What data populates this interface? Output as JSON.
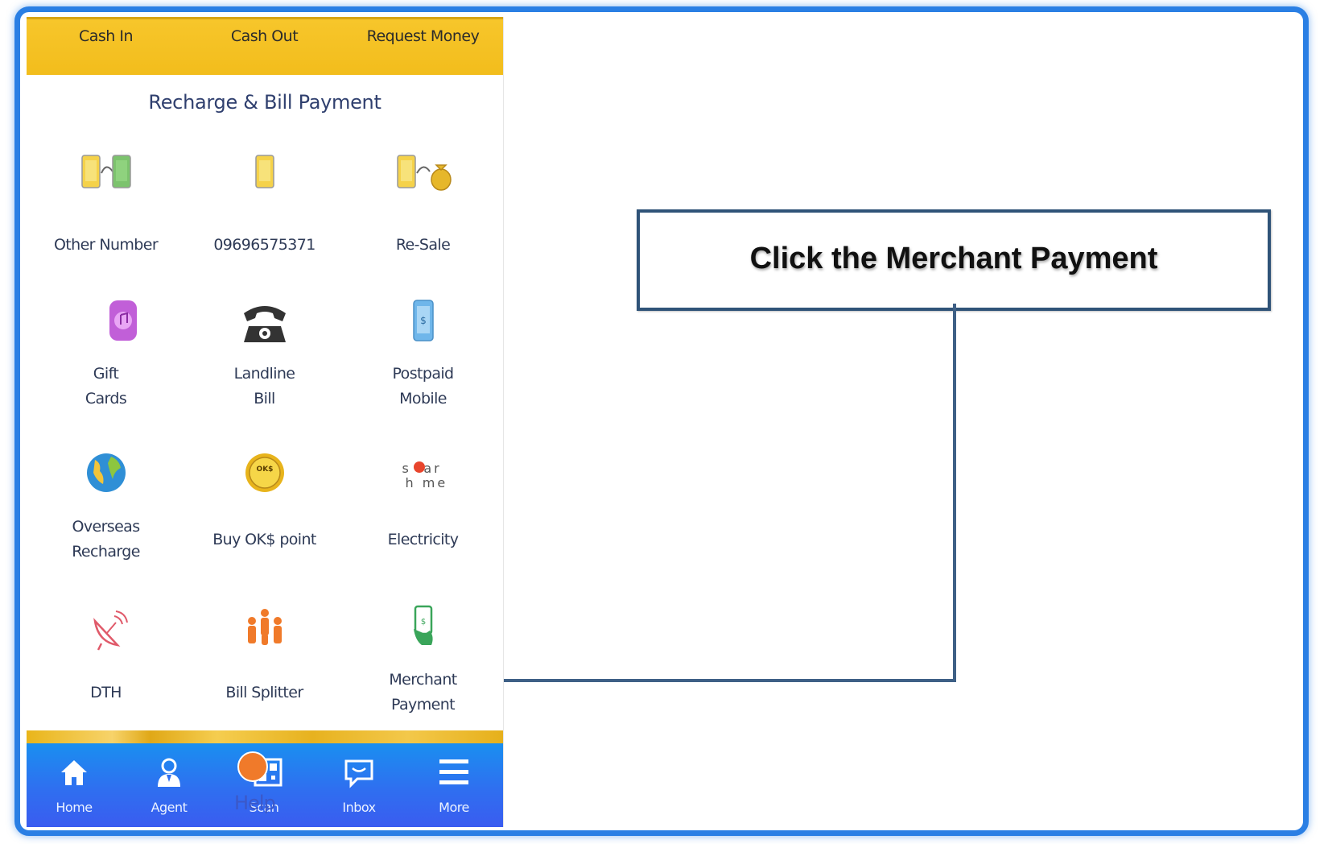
{
  "top_tabs": [
    "Cash In",
    "Cash Out",
    "Request Money"
  ],
  "section_title": "Recharge & Bill Payment",
  "grid": [
    {
      "icon": "phone-transfer-icon",
      "line1": "Other Number",
      "line2": ""
    },
    {
      "icon": "mobile-phone-icon",
      "line1": "09696575371",
      "line2": ""
    },
    {
      "icon": "phone-money-bag-icon",
      "line1": "Re-Sale",
      "line2": ""
    },
    {
      "icon": "gift-card-icon",
      "line1": "Gift",
      "line2": "Cards"
    },
    {
      "icon": "telephone-icon",
      "line1": "Landline",
      "line2": "Bill"
    },
    {
      "icon": "postpaid-mobile-icon",
      "line1": "Postpaid",
      "line2": "Mobile"
    },
    {
      "icon": "globe-icon",
      "line1": "Overseas",
      "line2": "Recharge"
    },
    {
      "icon": "ok-coin-icon",
      "line1": "Buy OK$ point",
      "line2": ""
    },
    {
      "icon": "solar-home-logo-icon",
      "line1": "Electricity",
      "line2": ""
    },
    {
      "icon": "satellite-dish-icon",
      "line1": "DTH",
      "line2": ""
    },
    {
      "icon": "people-group-icon",
      "line1": "Bill Splitter",
      "line2": ""
    },
    {
      "icon": "hand-phone-payment-icon",
      "line1": "Merchant",
      "line2": "Payment"
    }
  ],
  "bottom_nav": [
    "Home",
    "Agent",
    "Scan",
    "Inbox",
    "More"
  ],
  "help_label": "Help",
  "logo_text": {
    "solar_top": "s lar",
    "solar_bottom": "h me",
    "ok_coin": "OK$"
  },
  "callout_text": "Click the Merchant Payment",
  "colors": {
    "frame": "#2a7fe4",
    "topbar": "#f5c124",
    "bottombar": "#2f6ff0",
    "callout_border": "#2f5378"
  }
}
